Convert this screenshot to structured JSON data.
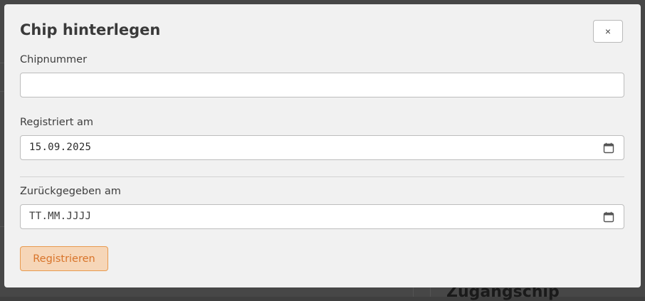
{
  "modal": {
    "title": "Chip hinterlegen",
    "close_label": "×"
  },
  "form": {
    "chip_number": {
      "label": "Chipnummer",
      "value": ""
    },
    "registered_on": {
      "label": "Registriert am",
      "value": "15.09.2025"
    },
    "returned_on": {
      "label": "Zurückgegeben am",
      "placeholder": "TT.MM.JJJJ"
    },
    "submit_label": "Registrieren"
  },
  "background": {
    "heading": "Zugangschip"
  },
  "colors": {
    "submit_bg": "#f6d6b8",
    "submit_border": "#e89a4f",
    "submit_text": "#d8742a",
    "modal_bg": "#f1f1f1"
  },
  "icons": {
    "close": "close-icon",
    "calendar": "calendar-icon"
  }
}
